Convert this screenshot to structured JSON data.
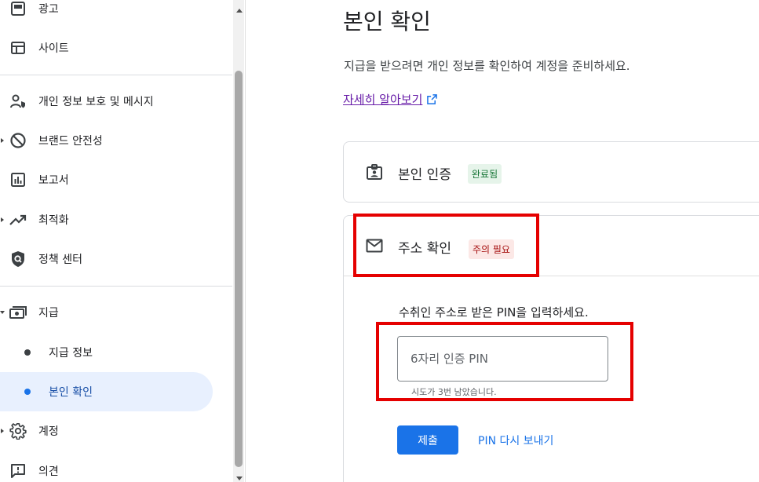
{
  "sidebar": {
    "items": [
      {
        "label": "광고",
        "icon": "ads-icon"
      },
      {
        "label": "사이트",
        "icon": "sites-icon"
      },
      {
        "label": "개인 정보 보호 및 메시지",
        "icon": "privacy-messaging-icon"
      },
      {
        "label": "브랜드 안전성",
        "icon": "block-icon"
      },
      {
        "label": "보고서",
        "icon": "reports-icon"
      },
      {
        "label": "최적화",
        "icon": "trending-up-icon"
      },
      {
        "label": "정책 센터",
        "icon": "policy-shield-icon"
      },
      {
        "label": "지급",
        "icon": "payments-icon"
      },
      {
        "label": "지급 정보"
      },
      {
        "label": "본인 확인"
      },
      {
        "label": "계정",
        "icon": "gear-icon"
      },
      {
        "label": "의견",
        "icon": "feedback-icon"
      }
    ]
  },
  "main": {
    "title": "본인 확인",
    "description": "지급을 받으려면 개인 정보를 확인하여 계정을 준비하세요.",
    "learn_more": "자세히 알아보기",
    "steps": [
      {
        "title": "본인 인증",
        "badge": "완료됨",
        "icon": "id-badge-icon"
      },
      {
        "title": "주소 확인",
        "badge": "주의 필요",
        "icon": "mail-icon"
      }
    ],
    "pin_prompt": "수취인 주소로 받은 PIN을 입력하세요.",
    "pin_placeholder": "6자리 인증 PIN",
    "attempts_left": "시도가 3번 남았습니다.",
    "submit_label": "제출",
    "resend_label": "PIN 다시 보내기"
  },
  "colors": {
    "accent": "#1a73e8",
    "success": "#137333",
    "warning": "#a50e0e",
    "highlight_box": "#e50000"
  }
}
